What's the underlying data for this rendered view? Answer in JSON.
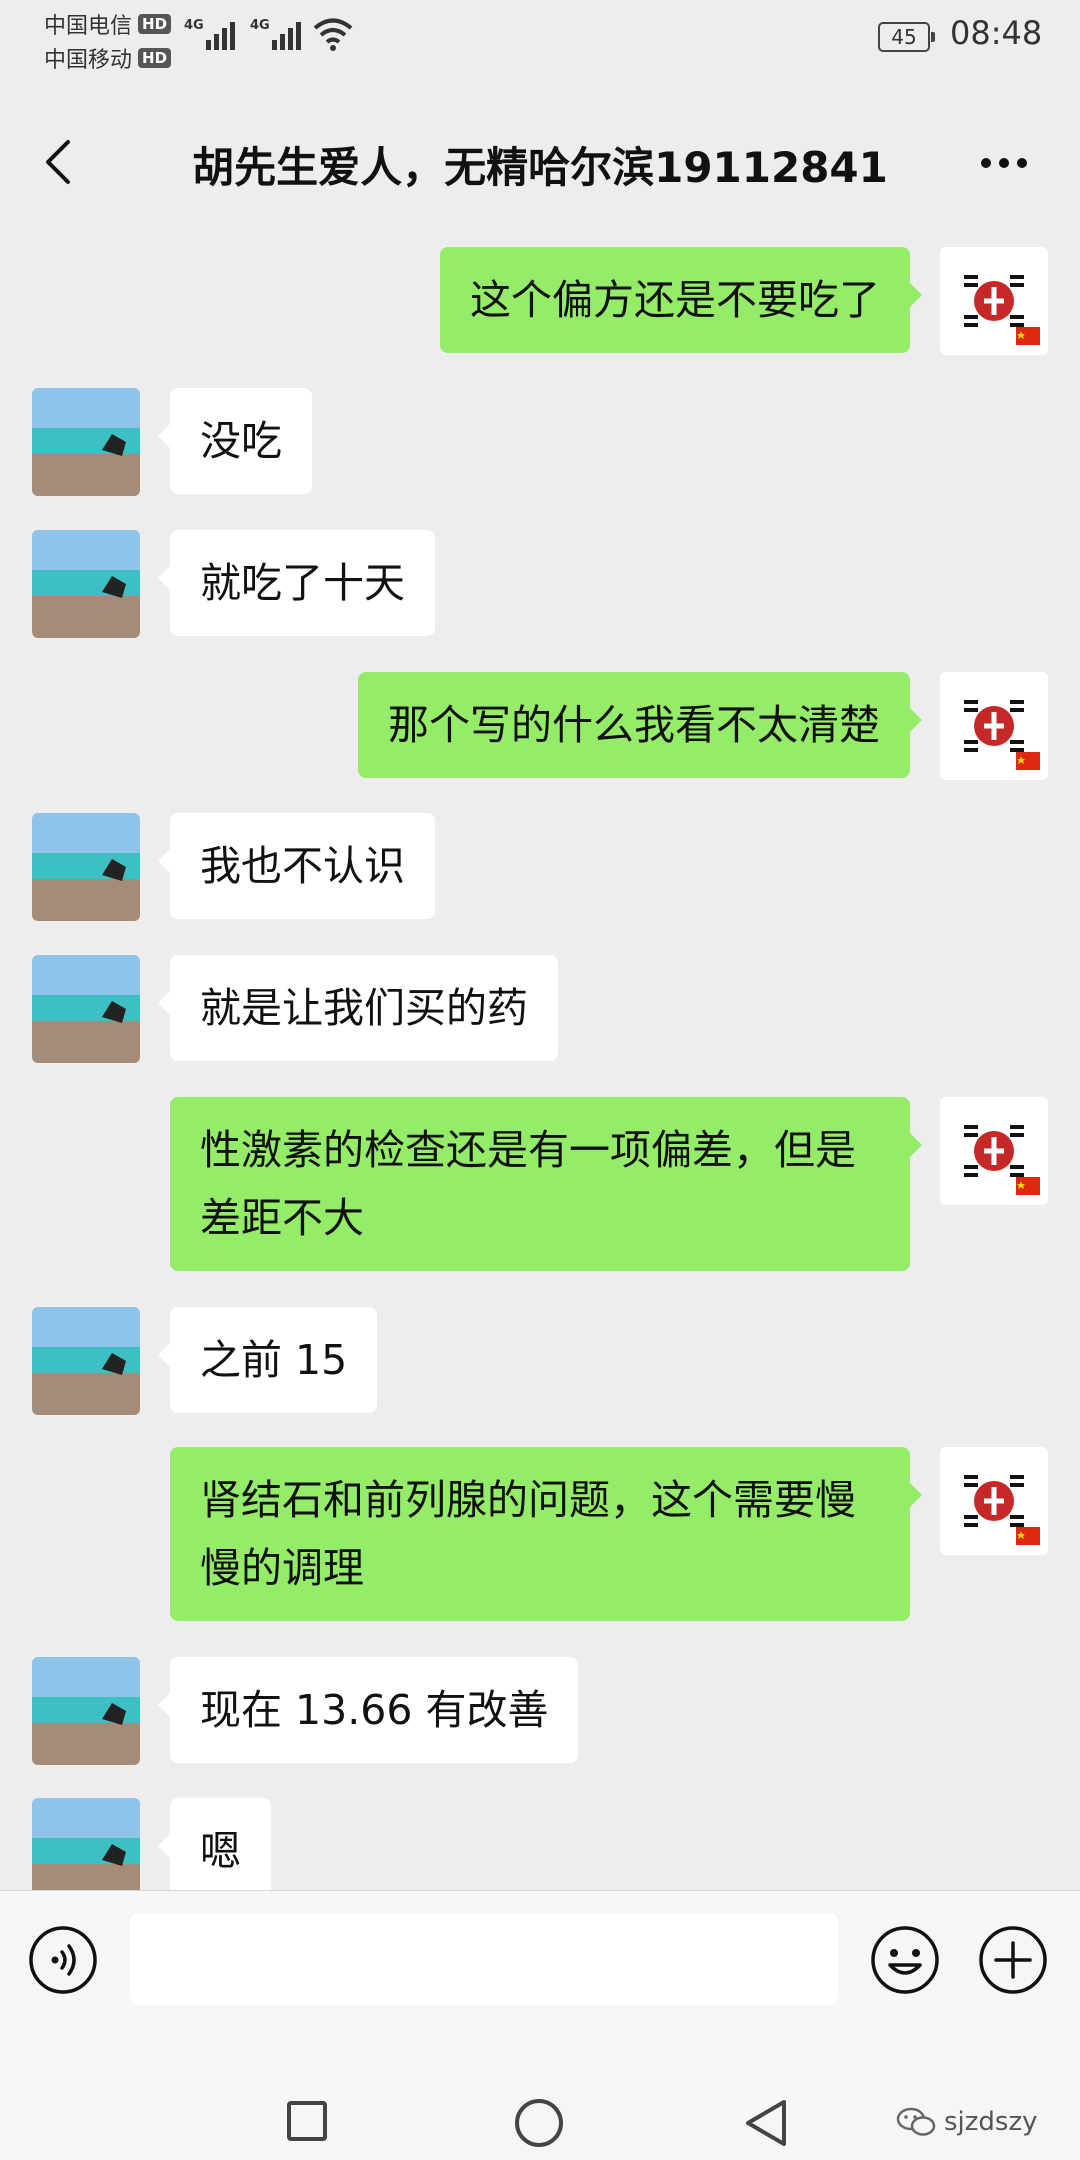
{
  "status_bar": {
    "carrier_1": "中国电信",
    "carrier_2": "中国移动",
    "hd_badge": "HD",
    "network_1": "4G",
    "network_2": "4G",
    "battery_level": "45",
    "time": "08:48"
  },
  "header": {
    "title": "胡先生爱人，无精哈尔滨19112841"
  },
  "messages": [
    {
      "side": "right",
      "text": "这个偏方还是不要吃了"
    },
    {
      "side": "left",
      "text": "没吃"
    },
    {
      "side": "left",
      "text": "就吃了十天"
    },
    {
      "side": "right",
      "text": "那个写的什么我看不太清楚"
    },
    {
      "side": "left",
      "text": "我也不认识"
    },
    {
      "side": "left",
      "text": "就是让我们买的药"
    },
    {
      "side": "right",
      "text": "性激素的检查还是有一项偏差，但是差距不大"
    },
    {
      "side": "left",
      "text": "之前 15"
    },
    {
      "side": "right",
      "text": "肾结石和前列腺的问题，这个需要慢慢的调理"
    },
    {
      "side": "left",
      "text": "现在 13.66 有改善"
    },
    {
      "side": "left",
      "text": "嗯"
    }
  ],
  "input_bar": {
    "placeholder": "",
    "icons": [
      "voice-icon",
      "emoji-icon",
      "plus-icon"
    ]
  },
  "nav_bar": {
    "icons": [
      "recent-apps-icon",
      "home-icon",
      "back-icon"
    ]
  },
  "watermark": {
    "text": "sjzdszy"
  },
  "colors": {
    "background": "#ededed",
    "outgoing_bubble": "#95ec69",
    "incoming_bubble": "#ffffff"
  }
}
